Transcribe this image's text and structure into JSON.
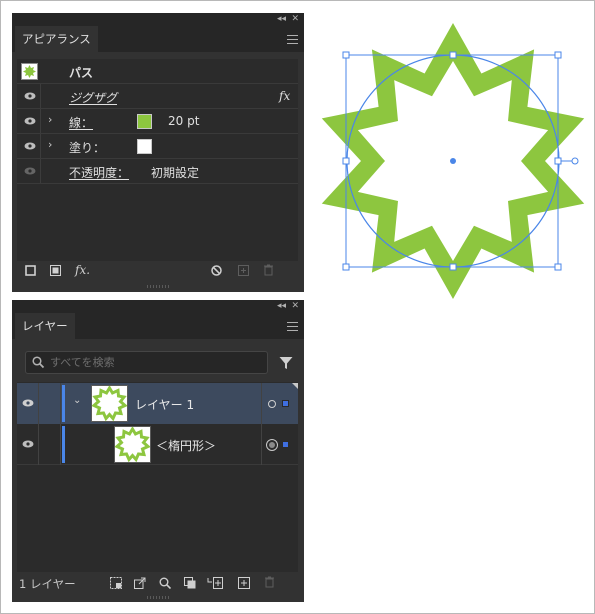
{
  "appearance_panel": {
    "tab_label": "アピアランス",
    "object_type": "パス",
    "rows": {
      "effect_label": "ジグザグ",
      "effect_fx": "fx",
      "stroke_label": "線：",
      "stroke_weight": "20 pt",
      "fill_label": "塗り：",
      "opacity_label": "不透明度：",
      "opacity_value": "初期設定"
    },
    "colors": {
      "stroke_swatch": "#8dc63f",
      "fill_swatch": "#ffffff",
      "path_icon": "#8dc63f"
    }
  },
  "layers_panel": {
    "tab_label": "レイヤー",
    "search_placeholder": "すべてを検索",
    "layers": [
      {
        "name": "レイヤー 1",
        "color": "#4a86e8"
      },
      {
        "name": "＜楕円形＞"
      }
    ],
    "footer_count": "1 レイヤー"
  },
  "canvas": {
    "shape_color": "#8dc63f",
    "selection_color": "#4a86e8"
  }
}
